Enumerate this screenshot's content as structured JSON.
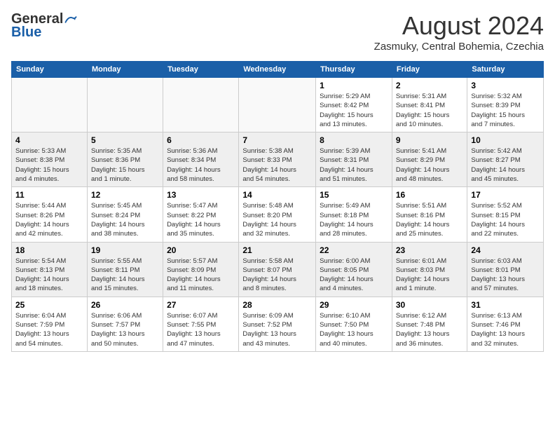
{
  "header": {
    "logo": {
      "part1": "General",
      "part2": "Blue"
    },
    "title": "August 2024",
    "subtitle": "Zasmuky, Central Bohemia, Czechia"
  },
  "calendar": {
    "headers": [
      "Sunday",
      "Monday",
      "Tuesday",
      "Wednesday",
      "Thursday",
      "Friday",
      "Saturday"
    ],
    "weeks": [
      [
        {
          "day": "",
          "info": ""
        },
        {
          "day": "",
          "info": ""
        },
        {
          "day": "",
          "info": ""
        },
        {
          "day": "",
          "info": ""
        },
        {
          "day": "1",
          "info": "Sunrise: 5:29 AM\nSunset: 8:42 PM\nDaylight: 15 hours\nand 13 minutes."
        },
        {
          "day": "2",
          "info": "Sunrise: 5:31 AM\nSunset: 8:41 PM\nDaylight: 15 hours\nand 10 minutes."
        },
        {
          "day": "3",
          "info": "Sunrise: 5:32 AM\nSunset: 8:39 PM\nDaylight: 15 hours\nand 7 minutes."
        }
      ],
      [
        {
          "day": "4",
          "info": "Sunrise: 5:33 AM\nSunset: 8:38 PM\nDaylight: 15 hours\nand 4 minutes."
        },
        {
          "day": "5",
          "info": "Sunrise: 5:35 AM\nSunset: 8:36 PM\nDaylight: 15 hours\nand 1 minute."
        },
        {
          "day": "6",
          "info": "Sunrise: 5:36 AM\nSunset: 8:34 PM\nDaylight: 14 hours\nand 58 minutes."
        },
        {
          "day": "7",
          "info": "Sunrise: 5:38 AM\nSunset: 8:33 PM\nDaylight: 14 hours\nand 54 minutes."
        },
        {
          "day": "8",
          "info": "Sunrise: 5:39 AM\nSunset: 8:31 PM\nDaylight: 14 hours\nand 51 minutes."
        },
        {
          "day": "9",
          "info": "Sunrise: 5:41 AM\nSunset: 8:29 PM\nDaylight: 14 hours\nand 48 minutes."
        },
        {
          "day": "10",
          "info": "Sunrise: 5:42 AM\nSunset: 8:27 PM\nDaylight: 14 hours\nand 45 minutes."
        }
      ],
      [
        {
          "day": "11",
          "info": "Sunrise: 5:44 AM\nSunset: 8:26 PM\nDaylight: 14 hours\nand 42 minutes."
        },
        {
          "day": "12",
          "info": "Sunrise: 5:45 AM\nSunset: 8:24 PM\nDaylight: 14 hours\nand 38 minutes."
        },
        {
          "day": "13",
          "info": "Sunrise: 5:47 AM\nSunset: 8:22 PM\nDaylight: 14 hours\nand 35 minutes."
        },
        {
          "day": "14",
          "info": "Sunrise: 5:48 AM\nSunset: 8:20 PM\nDaylight: 14 hours\nand 32 minutes."
        },
        {
          "day": "15",
          "info": "Sunrise: 5:49 AM\nSunset: 8:18 PM\nDaylight: 14 hours\nand 28 minutes."
        },
        {
          "day": "16",
          "info": "Sunrise: 5:51 AM\nSunset: 8:16 PM\nDaylight: 14 hours\nand 25 minutes."
        },
        {
          "day": "17",
          "info": "Sunrise: 5:52 AM\nSunset: 8:15 PM\nDaylight: 14 hours\nand 22 minutes."
        }
      ],
      [
        {
          "day": "18",
          "info": "Sunrise: 5:54 AM\nSunset: 8:13 PM\nDaylight: 14 hours\nand 18 minutes."
        },
        {
          "day": "19",
          "info": "Sunrise: 5:55 AM\nSunset: 8:11 PM\nDaylight: 14 hours\nand 15 minutes."
        },
        {
          "day": "20",
          "info": "Sunrise: 5:57 AM\nSunset: 8:09 PM\nDaylight: 14 hours\nand 11 minutes."
        },
        {
          "day": "21",
          "info": "Sunrise: 5:58 AM\nSunset: 8:07 PM\nDaylight: 14 hours\nand 8 minutes."
        },
        {
          "day": "22",
          "info": "Sunrise: 6:00 AM\nSunset: 8:05 PM\nDaylight: 14 hours\nand 4 minutes."
        },
        {
          "day": "23",
          "info": "Sunrise: 6:01 AM\nSunset: 8:03 PM\nDaylight: 14 hours\nand 1 minute."
        },
        {
          "day": "24",
          "info": "Sunrise: 6:03 AM\nSunset: 8:01 PM\nDaylight: 13 hours\nand 57 minutes."
        }
      ],
      [
        {
          "day": "25",
          "info": "Sunrise: 6:04 AM\nSunset: 7:59 PM\nDaylight: 13 hours\nand 54 minutes."
        },
        {
          "day": "26",
          "info": "Sunrise: 6:06 AM\nSunset: 7:57 PM\nDaylight: 13 hours\nand 50 minutes."
        },
        {
          "day": "27",
          "info": "Sunrise: 6:07 AM\nSunset: 7:55 PM\nDaylight: 13 hours\nand 47 minutes."
        },
        {
          "day": "28",
          "info": "Sunrise: 6:09 AM\nSunset: 7:52 PM\nDaylight: 13 hours\nand 43 minutes."
        },
        {
          "day": "29",
          "info": "Sunrise: 6:10 AM\nSunset: 7:50 PM\nDaylight: 13 hours\nand 40 minutes."
        },
        {
          "day": "30",
          "info": "Sunrise: 6:12 AM\nSunset: 7:48 PM\nDaylight: 13 hours\nand 36 minutes."
        },
        {
          "day": "31",
          "info": "Sunrise: 6:13 AM\nSunset: 7:46 PM\nDaylight: 13 hours\nand 32 minutes."
        }
      ]
    ]
  }
}
